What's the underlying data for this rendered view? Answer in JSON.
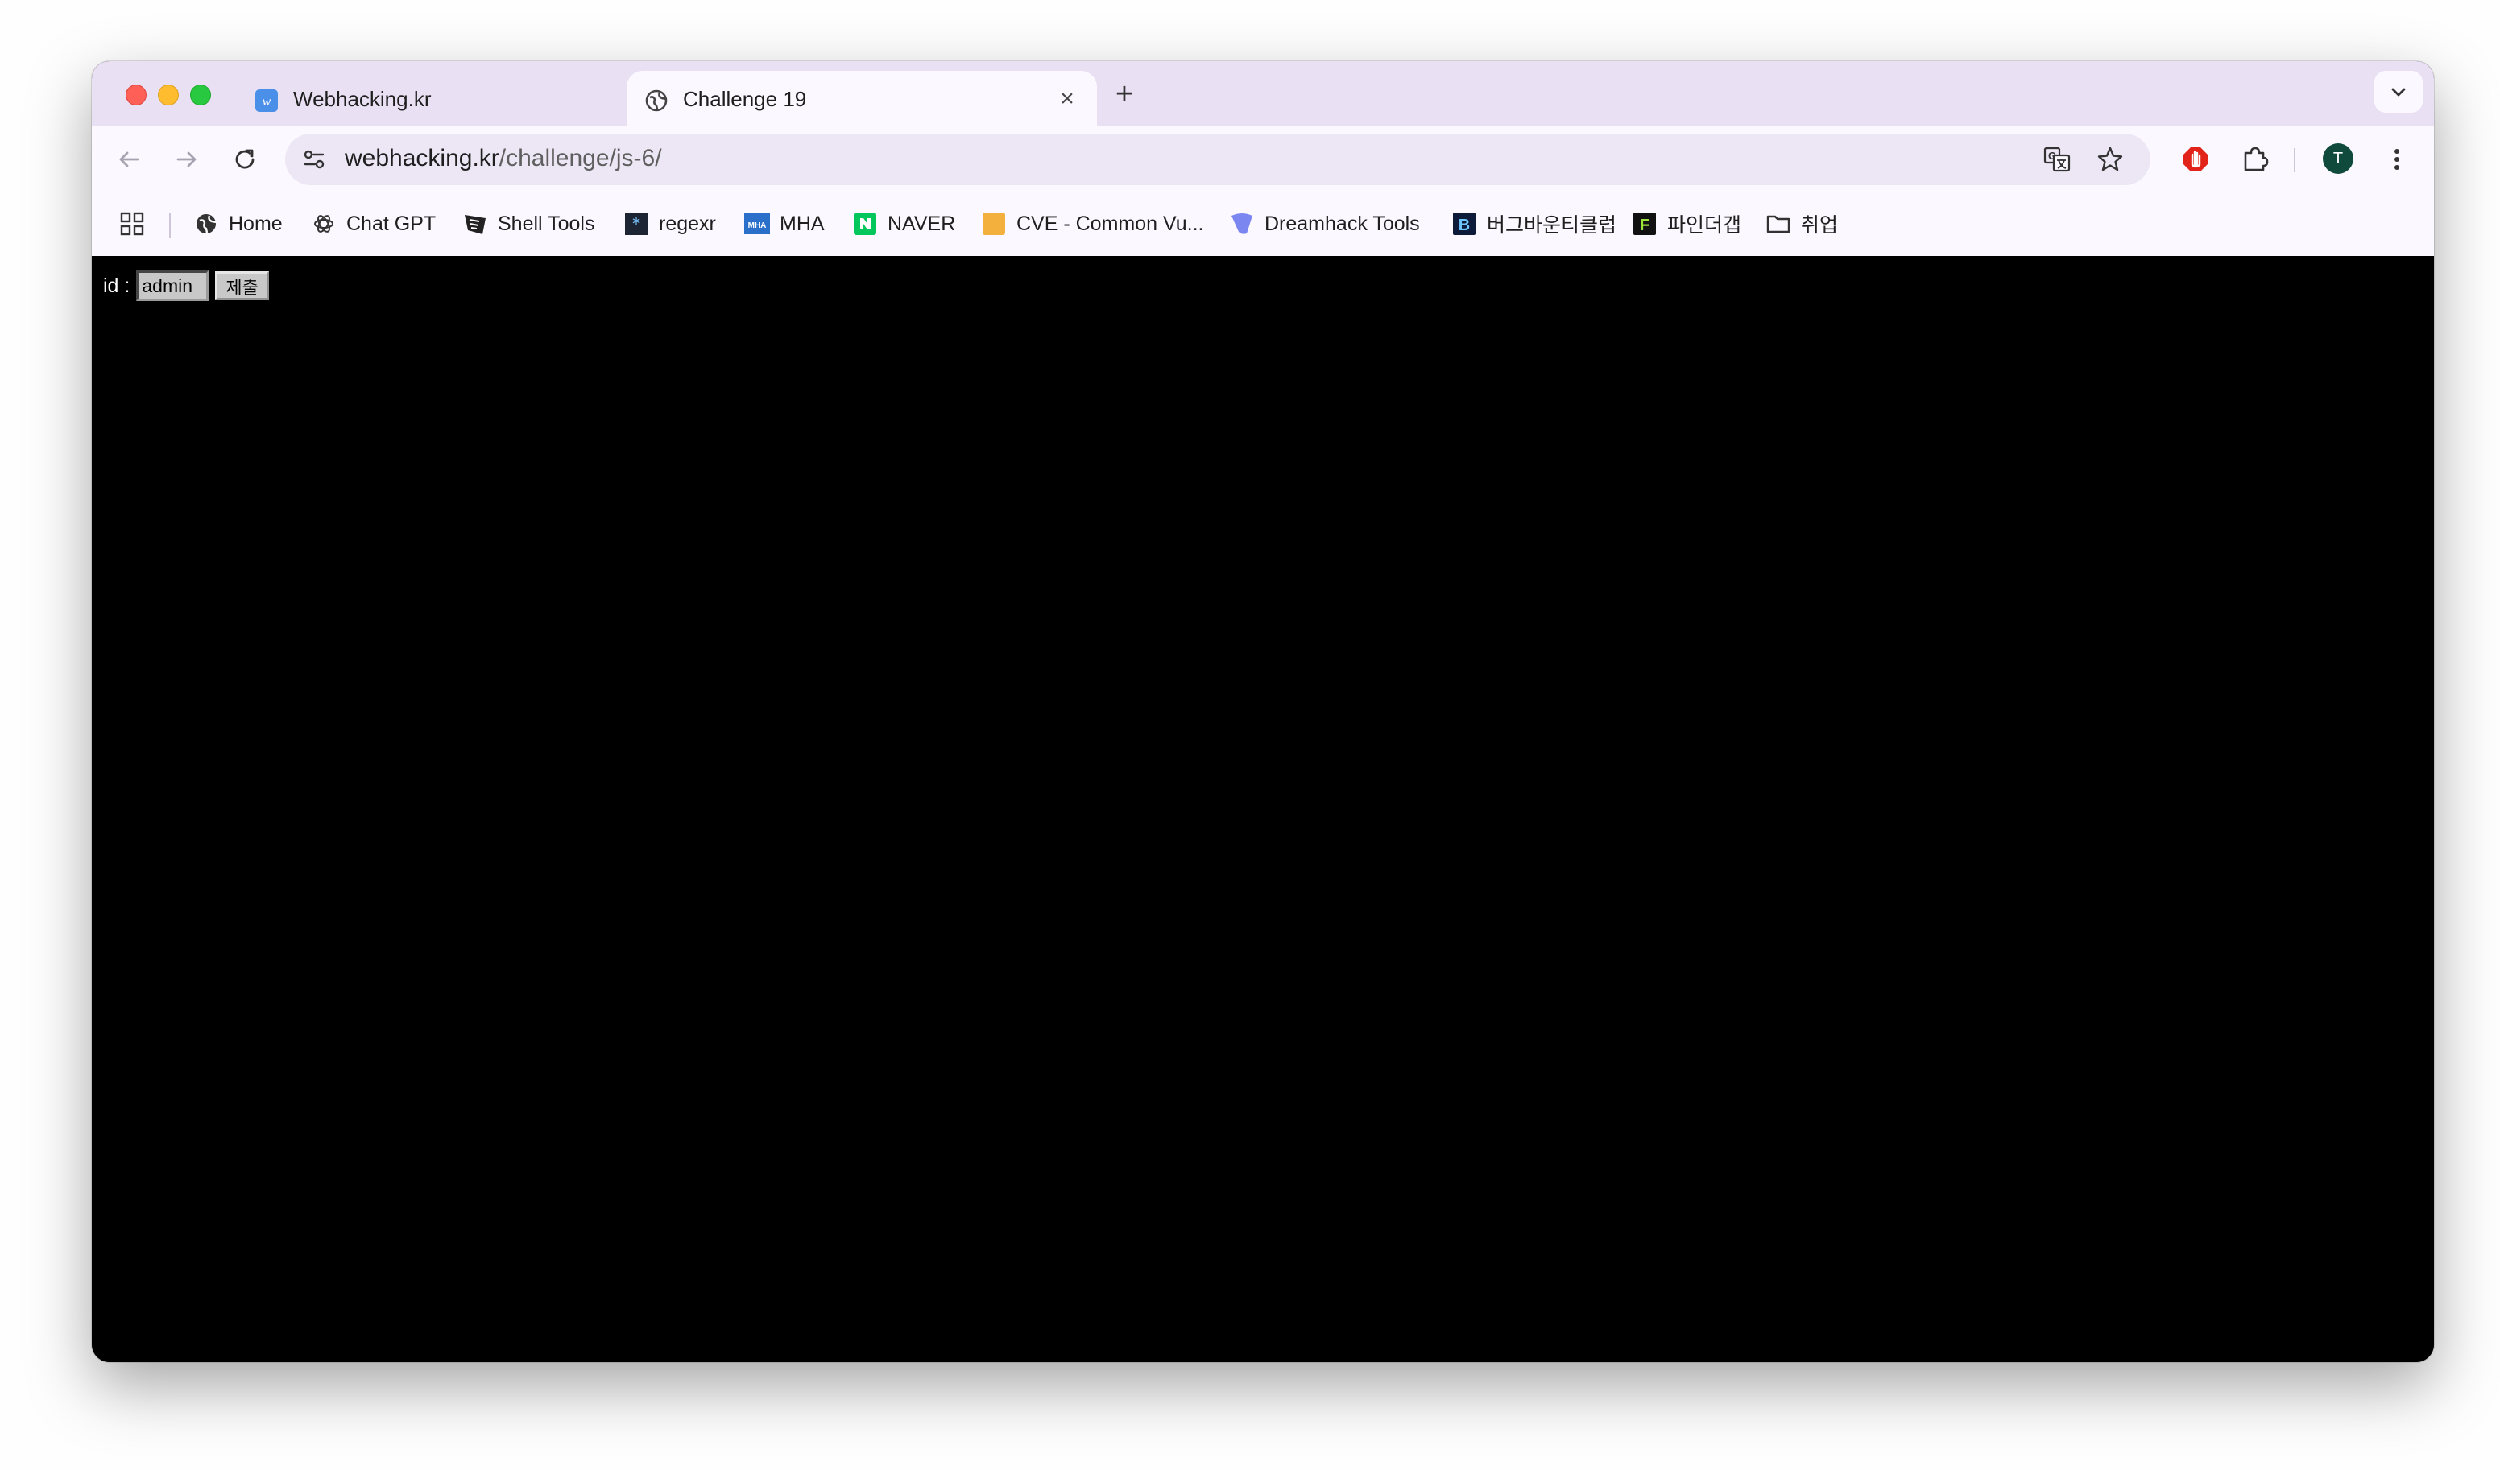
{
  "tabs": [
    {
      "title": "Webhacking.kr",
      "favicon": "w-favicon",
      "active": false
    },
    {
      "title": "Challenge 19",
      "favicon": "globe-icon",
      "active": true
    }
  ],
  "toolbar": {
    "url_host": "webhacking.kr",
    "url_path": "/challenge/js-6/",
    "avatar_letter": "T"
  },
  "bookmarks": [
    {
      "label": "Home",
      "icon": "globe-icon"
    },
    {
      "label": "Chat GPT",
      "icon": "openai-icon"
    },
    {
      "label": "Shell Tools",
      "icon": "shell-tools-icon"
    },
    {
      "label": "regexr",
      "icon": "regexr-icon"
    },
    {
      "label": "MHA",
      "icon": "mha-icon"
    },
    {
      "label": "NAVER",
      "icon": "naver-icon"
    },
    {
      "label": "CVE - Common Vu...",
      "icon": "cve-icon"
    },
    {
      "label": "Dreamhack Tools",
      "icon": "dreamhack-icon"
    },
    {
      "label": "버그바운티클럽",
      "icon": "bugbounty-icon"
    },
    {
      "label": "파인더갭",
      "icon": "findthegap-icon"
    },
    {
      "label": "취업",
      "icon": "folder-icon"
    }
  ],
  "page": {
    "id_label": "id :",
    "id_value": "admin",
    "submit_label": "제출"
  },
  "colors": {
    "tabstrip_bg": "#e9e0f4",
    "toolbar_bg": "#fcf8ff",
    "page_bg": "#000000",
    "naver_green": "#03c75a",
    "avatar_bg": "#0f4a3c"
  }
}
